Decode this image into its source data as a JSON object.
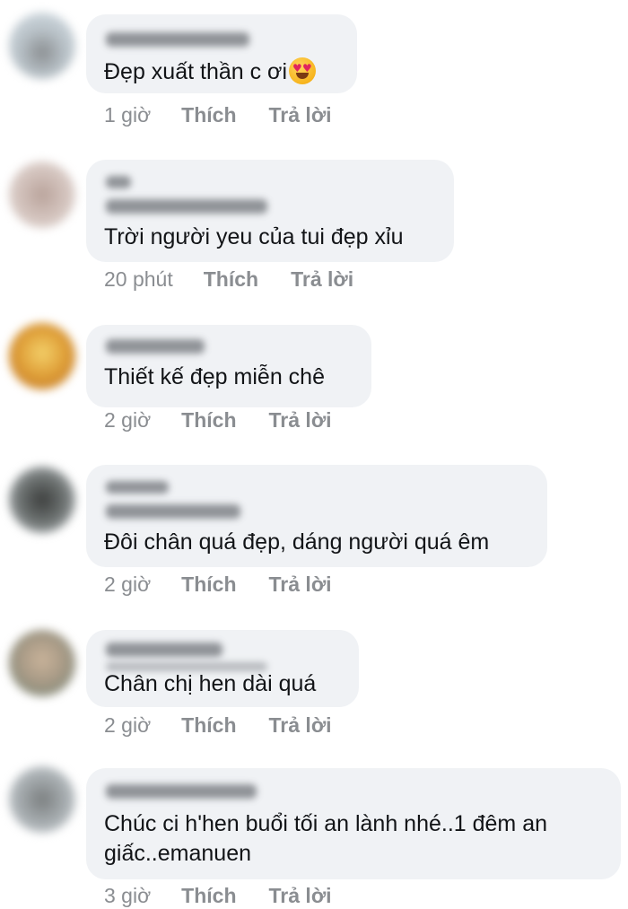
{
  "comments": [
    {
      "text": "Đẹp xuất thần c ơi",
      "has_emoji": true,
      "emoji": "heart-eyes-emoji",
      "time": "1 giờ",
      "like_label": "Thích",
      "reply_label": "Trả lời"
    },
    {
      "text": "Trời người yeu của tui đẹp xỉu",
      "time": "20 phút",
      "like_label": "Thích",
      "reply_label": "Trả lời"
    },
    {
      "text": "Thiết kế đẹp miễn chê",
      "time": "2 giờ",
      "like_label": "Thích",
      "reply_label": "Trả lời"
    },
    {
      "text": "Đôi chân quá đẹp, dáng người quá êm",
      "time": "2 giờ",
      "like_label": "Thích",
      "reply_label": "Trả lời"
    },
    {
      "text": "Chân chị hen dài quá",
      "time": "2 giờ",
      "like_label": "Thích",
      "reply_label": "Trả lời"
    },
    {
      "text": "Chúc ci h'hen buổi tối an lành nhé..1 đêm an giấc..emanuen",
      "time": "3 giờ",
      "like_label": "Thích",
      "reply_label": "Trả lời"
    }
  ]
}
